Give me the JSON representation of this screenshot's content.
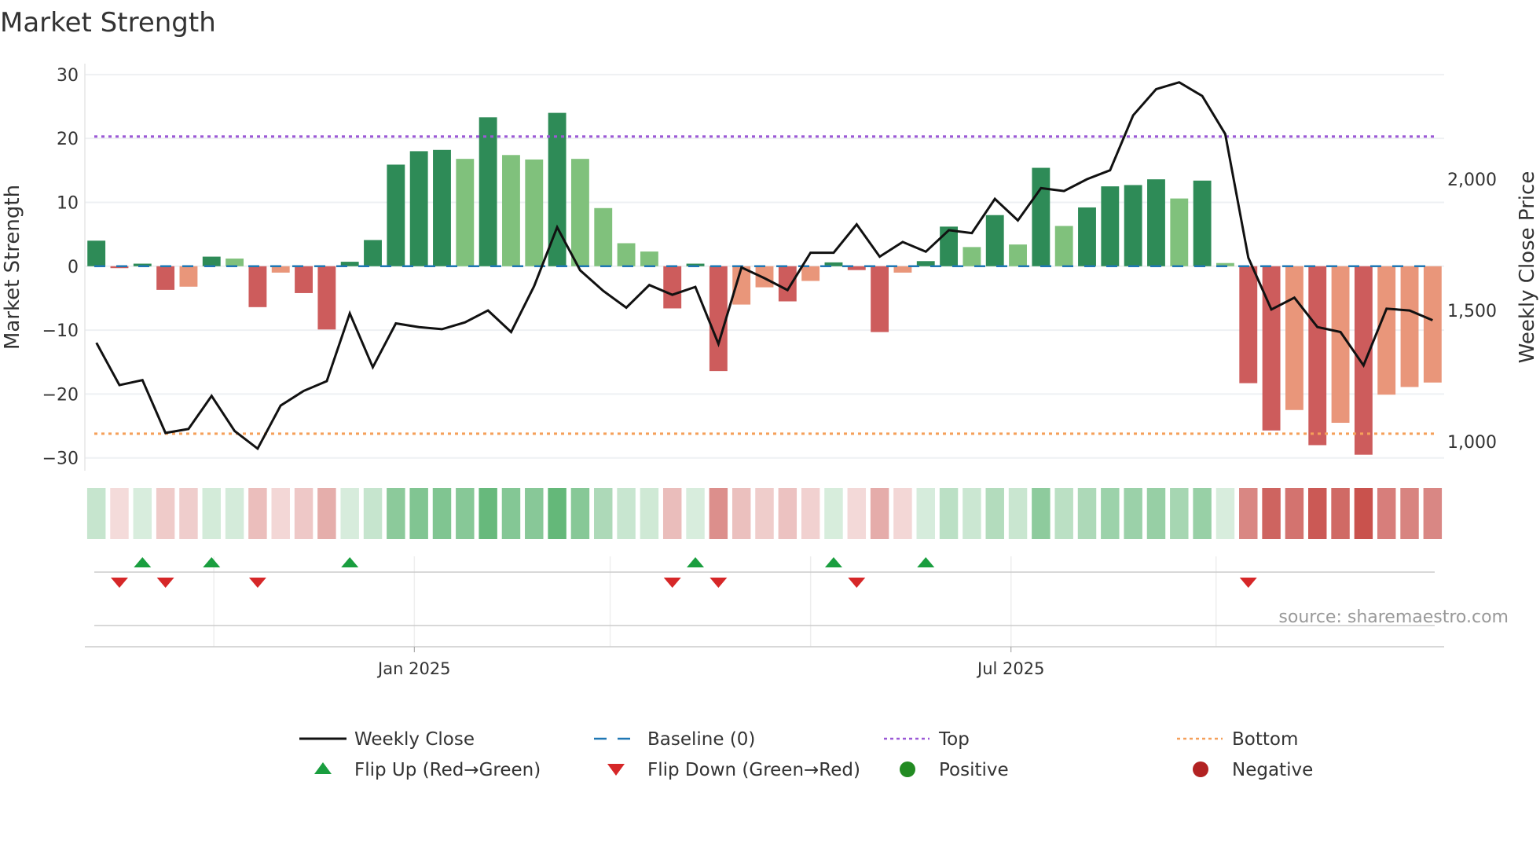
{
  "title": "Market Strength",
  "source": "source: sharemaestro.com",
  "colors": {
    "strong_up": "#2e8b57",
    "weak_up": "#80c17c",
    "strong_down": "#cd5c5c",
    "weak_down": "#e9967a",
    "close": "#111111",
    "baseline": "#1f77b4",
    "top": "#9b59d6",
    "bottom": "#f5a05a",
    "flip_up": "#1a9e3f",
    "flip_down": "#d62728",
    "positive": "#228b22",
    "negative": "#b22222"
  },
  "chart_data": {
    "type": "bar",
    "title": "Market Strength",
    "ylabel": "Market Strength",
    "y2label": "Weekly Close Price",
    "ylim": [
      -32,
      31.7
    ],
    "y2lim": [
      890,
      2440
    ],
    "yticks": [
      30,
      20,
      10,
      0,
      -10,
      -20,
      -30
    ],
    "ytick_labels": [
      "30",
      "20",
      "10",
      "0",
      "−10",
      "−20",
      "−30"
    ],
    "y2ticks": [
      2000,
      1500,
      1000
    ],
    "y2tick_labels": [
      "2,000",
      "1,500",
      "1,000"
    ],
    "xticks": [
      {
        "index": 14.3,
        "label": "Jan 2025"
      },
      {
        "index": 40.2,
        "label": "Jul 2025"
      }
    ],
    "minor_x_grid": [
      5.6,
      14.3,
      22.8,
      31.5,
      40.2,
      49.1
    ],
    "top_level": 20.3,
    "bottom_level": -26.2,
    "baseline": 0,
    "strength": [
      4.0,
      -0.3,
      0.4,
      -3.7,
      -3.2,
      1.5,
      1.2,
      -6.4,
      -1.0,
      -4.2,
      -9.9,
      0.7,
      4.1,
      15.9,
      18.0,
      18.2,
      16.8,
      23.3,
      17.4,
      16.7,
      24.0,
      16.8,
      9.1,
      3.6,
      2.3,
      -6.6,
      0.4,
      -16.4,
      -6.0,
      -3.3,
      -5.5,
      -2.3,
      0.6,
      -0.6,
      -10.3,
      -1.0,
      0.8,
      6.2,
      3.0,
      8.0,
      3.4,
      15.4,
      6.3,
      9.2,
      12.5,
      12.7,
      13.6,
      10.6,
      13.4,
      0.5,
      -18.3,
      -25.7,
      -22.5,
      -28.0,
      -24.5,
      -29.5,
      -20.1,
      -18.9,
      -18.2
    ],
    "weekly_close": [
      1377,
      1216,
      1235,
      1034,
      1049,
      1175,
      1041,
      974,
      1138,
      1194,
      1231,
      1489,
      1284,
      1451,
      1437,
      1429,
      1455,
      1500,
      1418,
      1593,
      1817,
      1653,
      1575,
      1511,
      1597,
      1560,
      1590,
      1373,
      1664,
      1623,
      1578,
      1720,
      1720,
      1828,
      1705,
      1761,
      1724,
      1806,
      1795,
      1925,
      1843,
      1966,
      1955,
      2000,
      2034,
      2243,
      2343,
      2369,
      2317,
      2172,
      1701,
      1504,
      1549,
      1437,
      1418,
      1291,
      1507,
      1500,
      1463
    ],
    "flip_up_indices": [
      2,
      5,
      11,
      26,
      32,
      36
    ],
    "flip_down_indices": [
      1,
      3,
      7,
      25,
      27,
      33,
      50
    ],
    "legend": {
      "placement": "bottom",
      "entries": [
        {
          "label": "Weekly Close",
          "kind": "line"
        },
        {
          "label": "Baseline (0)",
          "kind": "dash"
        },
        {
          "label": "Top",
          "kind": "dot-top"
        },
        {
          "label": "Bottom",
          "kind": "dot-bottom"
        },
        {
          "label": "Flip Up (Red→Green)",
          "kind": "tri-up"
        },
        {
          "label": "Flip Down (Green→Red)",
          "kind": "tri-down"
        },
        {
          "label": "Positive",
          "kind": "circle-pos"
        },
        {
          "label": "Negative",
          "kind": "circle-neg"
        }
      ]
    }
  }
}
